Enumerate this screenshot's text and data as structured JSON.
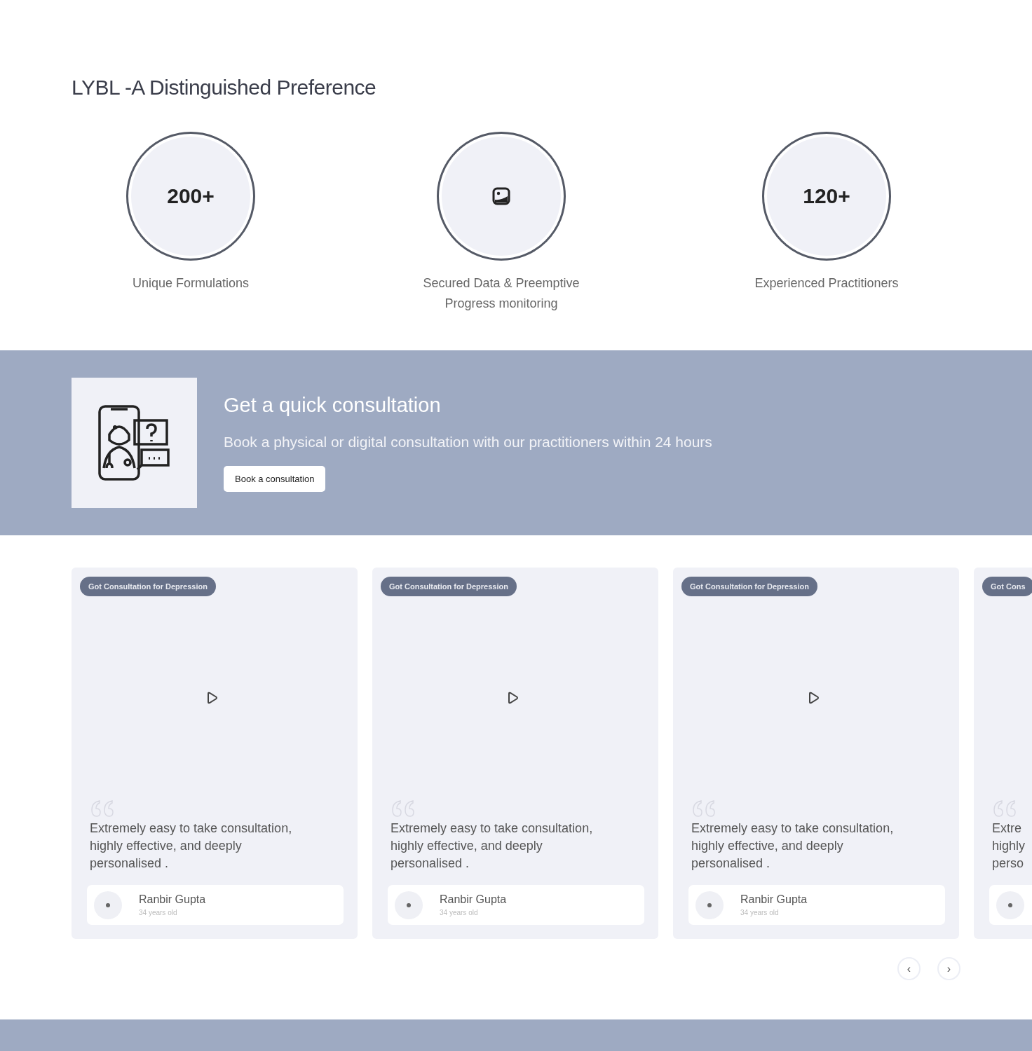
{
  "heading": "LYBL -A Distinguished Preference",
  "stats": [
    {
      "kind": "number",
      "value": "200+",
      "label": "Unique Formulations"
    },
    {
      "kind": "image",
      "label": "Secured Data & Preemptive Progress monitoring"
    },
    {
      "kind": "number",
      "value": "120+",
      "label": "Experienced Practitioners"
    }
  ],
  "banner": {
    "title": "Get a quick consultation",
    "subtitle": "Book a physical or digital consultation with our practitioners within 24 hours",
    "button": "Book a consultation"
  },
  "testimonials": [
    {
      "tag": "Got Consultation for Depression",
      "quote_lines": [
        "Extremely easy to take consultation,",
        "highly effective, and deeply",
        "personalised ."
      ],
      "name": "Ranbir Gupta",
      "age": "34 years old"
    },
    {
      "tag": "Got Consultation for Depression",
      "quote_lines": [
        "Extremely easy to take consultation,",
        "highly effective, and deeply",
        "personalised ."
      ],
      "name": "Ranbir Gupta",
      "age": "34 years old"
    },
    {
      "tag": "Got Consultation for Depression",
      "quote_lines": [
        "Extremely easy to take consultation,",
        "highly effective, and deeply",
        "personalised ."
      ],
      "name": "Ranbir Gupta",
      "age": "34 years old"
    },
    {
      "tag": "Got Cons",
      "quote_lines": [
        "Extre",
        "highly",
        "perso"
      ]
    }
  ],
  "carousel_nav": {
    "prev": "‹",
    "next": "›"
  }
}
